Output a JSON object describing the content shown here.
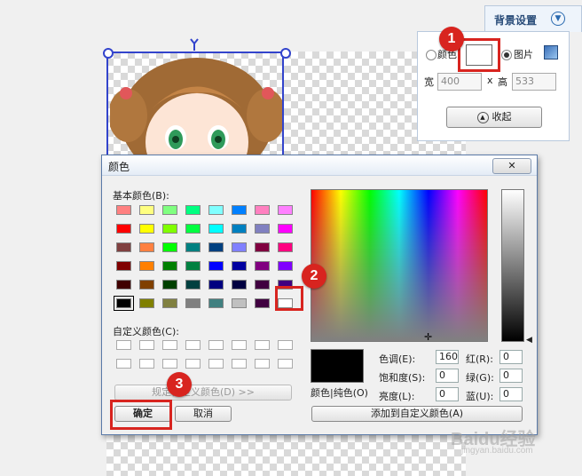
{
  "bg_panel": {
    "title": "背景设置",
    "radio_color": "颜色",
    "radio_image": "图片",
    "width_label": "宽",
    "width_value": "400",
    "x_sep": "x",
    "height_label": "高",
    "height_value": "533",
    "collapse_label": "收起"
  },
  "dialog": {
    "title": "颜色",
    "basic_colors_label": "基本颜色(B):",
    "custom_colors_label": "自定义颜色(C):",
    "define_custom_label": "规定自定义颜色(D) >>",
    "ok_label": "确定",
    "cancel_label": "取消",
    "color_solid_label": "颜色|纯色(O)",
    "hue_label": "色调(E):",
    "hue_value": "160",
    "sat_label": "饱和度(S):",
    "sat_value": "0",
    "lum_label": "亮度(L):",
    "lum_value": "0",
    "red_label": "红(R):",
    "red_value": "0",
    "green_label": "绿(G):",
    "green_value": "0",
    "blue_label": "蓝(U):",
    "blue_value": "0",
    "add_custom_label": "添加到自定义颜色(A)",
    "basic_colors": [
      "#ff8080",
      "#ffff80",
      "#80ff80",
      "#00ff80",
      "#80ffff",
      "#0080ff",
      "#ff80c0",
      "#ff80ff",
      "#ff0000",
      "#ffff00",
      "#80ff00",
      "#00ff40",
      "#00ffff",
      "#0080c0",
      "#8080c0",
      "#ff00ff",
      "#804040",
      "#ff8040",
      "#00ff00",
      "#008080",
      "#004080",
      "#8080ff",
      "#800040",
      "#ff0080",
      "#800000",
      "#ff8000",
      "#008000",
      "#008040",
      "#0000ff",
      "#0000a0",
      "#800080",
      "#8000ff",
      "#400000",
      "#804000",
      "#004000",
      "#004040",
      "#000080",
      "#000040",
      "#400040",
      "#400080",
      "#000000",
      "#808000",
      "#808040",
      "#808080",
      "#408080",
      "#c0c0c0",
      "#400040",
      "#ffffff"
    ]
  },
  "callouts": [
    "1",
    "2",
    "3"
  ],
  "watermark": {
    "text": "Baidu经验",
    "sub": "jingyan.baidu.com"
  }
}
